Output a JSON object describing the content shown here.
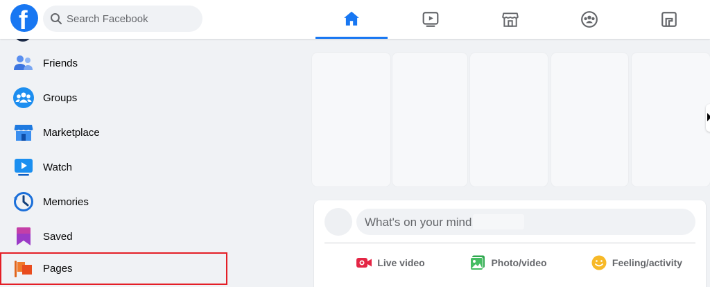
{
  "header": {
    "search_placeholder": "Search Facebook",
    "logo_letter": "f",
    "nav_tabs": [
      {
        "name": "home",
        "icon": "home-icon",
        "active": true
      },
      {
        "name": "watch",
        "icon": "watch-icon",
        "active": false
      },
      {
        "name": "marketplace",
        "icon": "marketplace-icon",
        "active": false
      },
      {
        "name": "groups",
        "icon": "groups-icon",
        "active": false
      },
      {
        "name": "gaming",
        "icon": "gaming-icon",
        "active": false
      }
    ]
  },
  "sidebar": {
    "items": [
      {
        "label": "Friends",
        "icon": "friends-icon"
      },
      {
        "label": "Groups",
        "icon": "groups-icon"
      },
      {
        "label": "Marketplace",
        "icon": "marketplace-icon"
      },
      {
        "label": "Watch",
        "icon": "watch-icon"
      },
      {
        "label": "Memories",
        "icon": "memories-icon"
      },
      {
        "label": "Saved",
        "icon": "saved-icon"
      },
      {
        "label": "Pages",
        "icon": "pages-icon",
        "highlighted": true
      }
    ]
  },
  "composer": {
    "prompt": "What's on your mind,",
    "actions": [
      {
        "label": "Live video",
        "icon": "live-video-icon"
      },
      {
        "label": "Photo/video",
        "icon": "photo-video-icon"
      },
      {
        "label": "Feeling/activity",
        "icon": "feeling-activity-icon"
      }
    ]
  },
  "colors": {
    "brand": "#1877f2",
    "highlight_border": "#e41e26",
    "background": "#f0f2f5"
  }
}
